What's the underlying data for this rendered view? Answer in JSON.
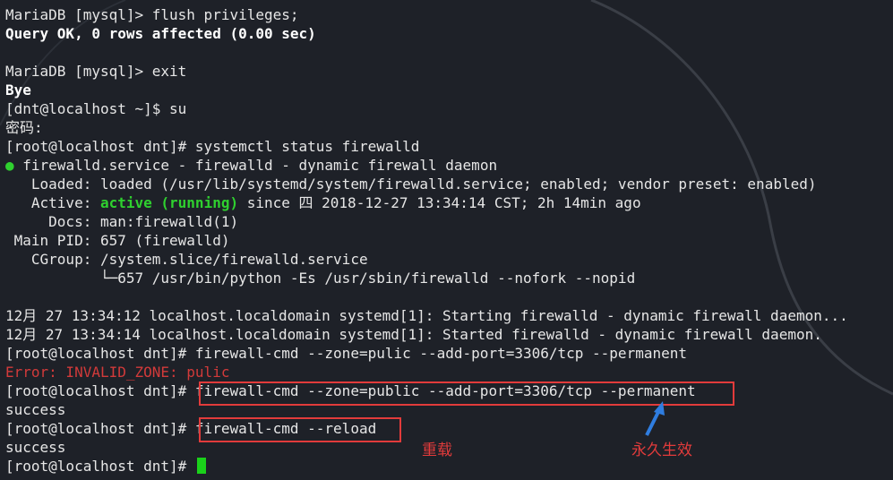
{
  "terminal": {
    "lines": {
      "l1": "MariaDB [mysql]> flush privileges;",
      "l2": "Query OK, 0 rows affected (0.00 sec)",
      "l4": "MariaDB [mysql]> exit",
      "l5": "Bye",
      "l6": "[dnt@localhost ~]$ su",
      "l7": "密码:",
      "l8": "[root@localhost dnt]# systemctl status firewalld",
      "l9_dot": "●",
      "l9": " firewalld.service - firewalld - dynamic firewall daemon",
      "l10": "   Loaded: loaded (/usr/lib/systemd/system/firewalld.service; enabled; vendor preset: enabled)",
      "l11_a": "   Active: ",
      "l11_b": "active (running)",
      "l11_c": " since 四 2018-12-27 13:34:14 CST; 2h 14min ago",
      "l12": "     Docs: man:firewalld(1)",
      "l13": " Main PID: 657 (firewalld)",
      "l14": "   CGroup: /system.slice/firewalld.service",
      "l15": "           └─657 /usr/bin/python -Es /usr/sbin/firewalld --nofork --nopid",
      "l17": "12月 27 13:34:12 localhost.localdomain systemd[1]: Starting firewalld - dynamic firewall daemon...",
      "l18": "12月 27 13:34:14 localhost.localdomain systemd[1]: Started firewalld - dynamic firewall daemon.",
      "l19": "[root@localhost dnt]# firewall-cmd --zone=pulic --add-port=3306/tcp --permanent",
      "l20": "Error: INVALID_ZONE: pulic",
      "l21": "[root@localhost dnt]# firewall-cmd --zone=public --add-port=3306/tcp --permanent",
      "l22": "success",
      "l23": "[root@localhost dnt]# firewall-cmd --reload",
      "l24": "success",
      "l25": "[root@localhost dnt]# "
    }
  },
  "annotations": {
    "reload_note": "重载",
    "permanent_note": "永久生效",
    "color": "#e23b3b"
  },
  "colors": {
    "background": "#1e2128",
    "text": "#e6e6e6",
    "green": "#2fd02f",
    "error": "#d23a3a"
  }
}
